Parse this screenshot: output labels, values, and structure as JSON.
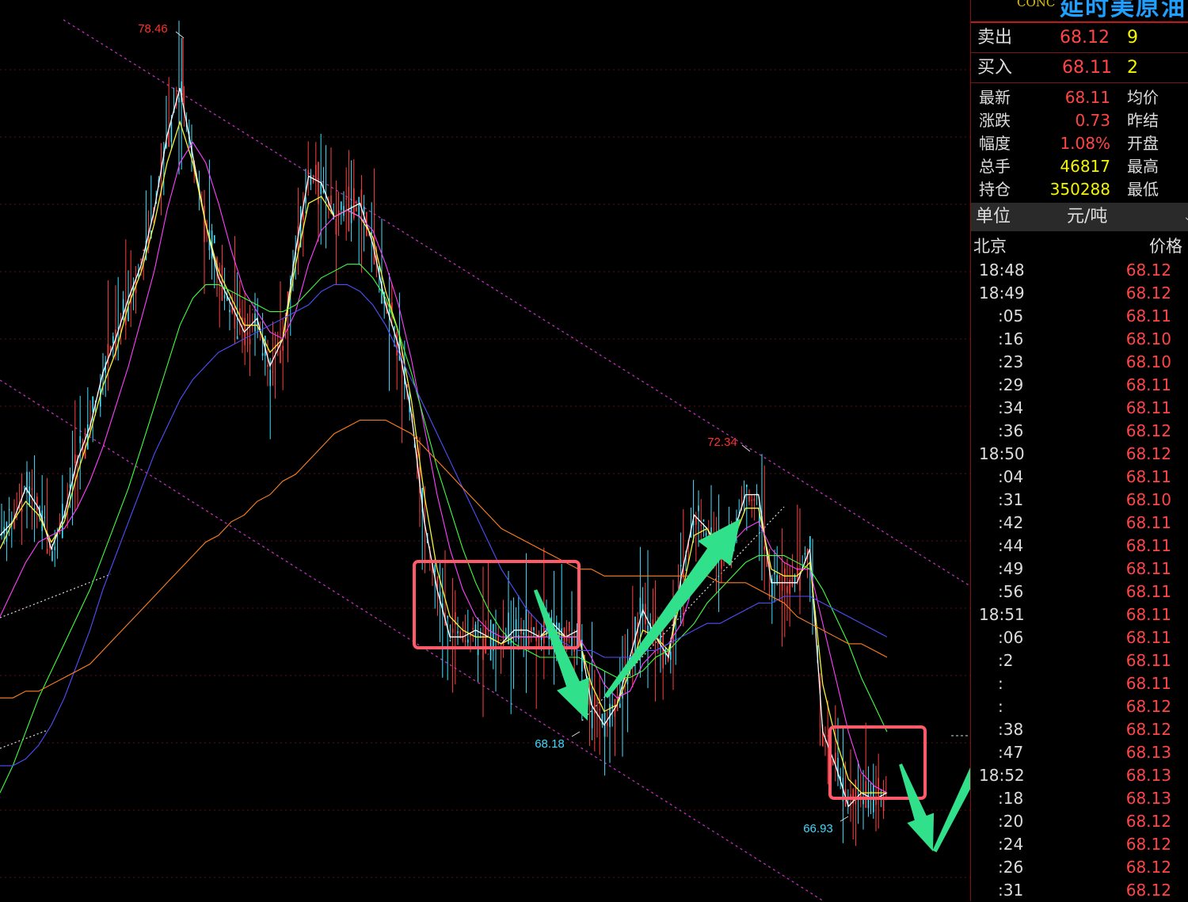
{
  "header": {
    "code": "CONC",
    "name": "延时美原油"
  },
  "order_book": {
    "sell": {
      "label": "卖出",
      "price": "68.12",
      "volume": "9"
    },
    "buy": {
      "label": "买入",
      "price": "68.11",
      "volume": "2"
    }
  },
  "quote": [
    {
      "label": "最新",
      "value": "68.11",
      "label2": "均价",
      "color": "#ff4545"
    },
    {
      "label": "涨跌",
      "value": "0.73",
      "label2": "昨结",
      "color": "#ff4545"
    },
    {
      "label": "幅度",
      "value": "1.08%",
      "label2": "开盘",
      "color": "#ff4545"
    },
    {
      "label": "总手",
      "value": "46817",
      "label2": "最高",
      "color": "#f5f500"
    },
    {
      "label": "持仓",
      "value": "350288",
      "label2": "最低",
      "color": "#f5f500"
    }
  ],
  "unit": {
    "label": "单位",
    "value": "元/吨"
  },
  "ticks_header": {
    "time": "北京",
    "price": "价格"
  },
  "ticks": [
    {
      "time": "18:48",
      "price": "68.12"
    },
    {
      "time": "18:49",
      "price": "68.12"
    },
    {
      "time": ":05",
      "price": "68.11"
    },
    {
      "time": ":16",
      "price": "68.10"
    },
    {
      "time": ":23",
      "price": "68.10"
    },
    {
      "time": ":29",
      "price": "68.11"
    },
    {
      "time": ":34",
      "price": "68.11"
    },
    {
      "time": ":36",
      "price": "68.12"
    },
    {
      "time": "18:50",
      "price": "68.12"
    },
    {
      "time": ":04",
      "price": "68.11"
    },
    {
      "time": ":31",
      "price": "68.10"
    },
    {
      "time": ":42",
      "price": "68.11"
    },
    {
      "time": ":44",
      "price": "68.11"
    },
    {
      "time": ":49",
      "price": "68.11"
    },
    {
      "time": ":56",
      "price": "68.11"
    },
    {
      "time": "18:51",
      "price": "68.11"
    },
    {
      "time": ":06",
      "price": "68.11"
    },
    {
      "time": ":2",
      "price": "68.11"
    },
    {
      "time": ":",
      "price": "68.11"
    },
    {
      "time": ":",
      "price": "68.12"
    },
    {
      "time": ":38",
      "price": "68.12"
    },
    {
      "time": ":47",
      "price": "68.13"
    },
    {
      "time": "18:52",
      "price": "68.13"
    },
    {
      "time": ":18",
      "price": "68.13"
    },
    {
      "time": ":20",
      "price": "68.12"
    },
    {
      "time": ":24",
      "price": "68.12"
    },
    {
      "time": ":26",
      "price": "68.12"
    },
    {
      "time": ":31",
      "price": "68.12"
    }
  ],
  "chart_data": {
    "type": "line",
    "annotations": [
      {
        "text": "78.46",
        "value": 78.46,
        "kind": "high",
        "color": "#ff3030"
      },
      {
        "text": "72.34",
        "value": 72.34,
        "kind": "high",
        "color": "#ff3030"
      },
      {
        "text": "68.18",
        "value": 68.18,
        "kind": "low",
        "color": "#40d8ff"
      },
      {
        "text": "66.93",
        "value": 66.93,
        "kind": "low",
        "color": "#40d8ff"
      }
    ],
    "ylim": [
      66.0,
      79.3
    ],
    "series": [
      {
        "color": "#ffffff",
        "values": [
          71.4,
          71.6,
          72.1,
          71.8,
          71.2,
          71.7,
          72.5,
          73.0,
          73.8,
          74.3,
          74.9,
          75.4,
          76.2,
          77.3,
          78.0,
          77.0,
          76.0,
          75.2,
          74.8,
          74.4,
          74.6,
          73.9,
          74.3,
          75.6,
          76.7,
          76.6,
          76.1,
          76.2,
          76.3,
          75.7,
          74.8,
          74.2,
          73.2,
          71.6,
          70.6,
          69.9,
          69.9,
          70.0,
          69.9,
          69.8,
          70.0,
          70.0,
          69.9,
          70.1,
          69.9,
          70.0,
          68.9,
          68.6,
          68.9,
          69.6,
          70.3,
          69.9,
          69.6,
          70.8,
          71.7,
          71.5,
          71.1,
          71.4,
          72.0,
          72.0,
          70.7,
          70.7,
          70.7,
          71.2,
          68.5,
          68.0,
          67.4,
          67.6,
          67.5,
          67.6
        ]
      },
      {
        "color": "#f5f538",
        "values": [
          71.2,
          71.6,
          71.9,
          71.7,
          71.3,
          71.6,
          72.3,
          72.9,
          73.6,
          74.1,
          74.8,
          75.3,
          76.0,
          76.9,
          77.5,
          76.9,
          76.0,
          75.3,
          74.9,
          74.5,
          74.5,
          74.1,
          74.3,
          75.4,
          76.3,
          76.4,
          76.1,
          76.2,
          76.1,
          75.8,
          75.0,
          74.4,
          73.4,
          72.0,
          70.9,
          70.2,
          70.0,
          69.9,
          69.9,
          69.8,
          69.9,
          69.9,
          69.9,
          70.0,
          69.9,
          69.9,
          69.2,
          68.8,
          68.9,
          69.4,
          70.0,
          69.9,
          69.7,
          70.5,
          71.4,
          71.5,
          71.2,
          71.3,
          71.8,
          71.8,
          70.9,
          70.8,
          70.8,
          71.0,
          69.2,
          68.4,
          67.8,
          67.6,
          67.6,
          67.6
        ]
      },
      {
        "color": "#ff40ff",
        "values": [
          70.2,
          70.6,
          71.0,
          71.3,
          71.4,
          71.5,
          71.8,
          72.2,
          72.7,
          73.3,
          73.9,
          74.6,
          75.3,
          76.2,
          76.9,
          77.2,
          76.9,
          76.3,
          75.6,
          75.0,
          74.7,
          74.4,
          74.3,
          74.7,
          75.4,
          75.9,
          76.1,
          76.2,
          76.1,
          75.9,
          75.4,
          74.8,
          74.0,
          73.0,
          72.0,
          71.2,
          70.6,
          70.2,
          70.0,
          69.9,
          69.9,
          69.9,
          69.9,
          69.9,
          69.9,
          69.9,
          69.6,
          69.2,
          69.0,
          69.1,
          69.5,
          69.7,
          69.8,
          70.1,
          70.7,
          71.1,
          71.3,
          71.3,
          71.5,
          71.6,
          71.2,
          71.0,
          70.9,
          70.9,
          70.1,
          69.3,
          68.5,
          67.9,
          67.7,
          67.6
        ]
      },
      {
        "color": "#40ff40",
        "values": [
          67.6,
          68.0,
          68.5,
          69.0,
          69.4,
          69.8,
          70.2,
          70.6,
          71.1,
          71.6,
          72.1,
          72.7,
          73.3,
          73.9,
          74.5,
          74.9,
          75.1,
          75.1,
          75.0,
          74.9,
          74.8,
          74.7,
          74.7,
          74.8,
          75.0,
          75.2,
          75.3,
          75.4,
          75.4,
          75.2,
          74.9,
          74.4,
          73.8,
          73.1,
          72.4,
          71.8,
          71.2,
          70.7,
          70.3,
          70.0,
          69.8,
          69.7,
          69.6,
          69.6,
          69.6,
          69.6,
          69.5,
          69.4,
          69.3,
          69.3,
          69.4,
          69.6,
          69.7,
          69.9,
          70.1,
          70.4,
          70.6,
          70.8,
          71.0,
          71.1,
          71.1,
          71.1,
          71.0,
          70.9,
          70.6,
          70.2,
          69.8,
          69.3,
          68.9,
          68.5
        ]
      },
      {
        "color": "#5050ff",
        "values": [
          68.0,
          68.0,
          68.1,
          68.3,
          68.6,
          69.0,
          69.5,
          70.0,
          70.6,
          71.1,
          71.6,
          72.1,
          72.6,
          73.0,
          73.4,
          73.7,
          73.9,
          74.1,
          74.2,
          74.3,
          74.4,
          74.5,
          74.6,
          74.7,
          74.8,
          75.0,
          75.1,
          75.1,
          75.0,
          74.8,
          74.5,
          74.1,
          73.7,
          73.3,
          72.9,
          72.5,
          72.1,
          71.7,
          71.3,
          70.9,
          70.6,
          70.3,
          70.1,
          69.9,
          69.8,
          69.7,
          69.7,
          69.6,
          69.6,
          69.6,
          69.7,
          69.7,
          69.8,
          69.9,
          70.0,
          70.1,
          70.1,
          70.2,
          70.3,
          70.4,
          70.4,
          70.5,
          70.5,
          70.5,
          70.4,
          70.3,
          70.2,
          70.1,
          70.0,
          69.9
        ]
      },
      {
        "color": "#ff8020",
        "values": [
          69.0,
          69.0,
          69.1,
          69.1,
          69.2,
          69.3,
          69.4,
          69.5,
          69.7,
          69.9,
          70.1,
          70.3,
          70.5,
          70.7,
          70.9,
          71.1,
          71.3,
          71.4,
          71.6,
          71.7,
          71.9,
          72.0,
          72.2,
          72.3,
          72.5,
          72.7,
          72.9,
          73.0,
          73.1,
          73.1,
          73.1,
          73.0,
          72.9,
          72.7,
          72.5,
          72.3,
          72.1,
          71.9,
          71.7,
          71.5,
          71.4,
          71.3,
          71.2,
          71.1,
          71.0,
          70.9,
          70.9,
          70.8,
          70.8,
          70.8,
          70.8,
          70.8,
          70.8,
          70.8,
          70.8,
          70.8,
          70.7,
          70.7,
          70.7,
          70.6,
          70.5,
          70.4,
          70.2,
          70.1,
          70.0,
          69.9,
          69.8,
          69.8,
          69.7,
          69.6
        ]
      }
    ]
  }
}
